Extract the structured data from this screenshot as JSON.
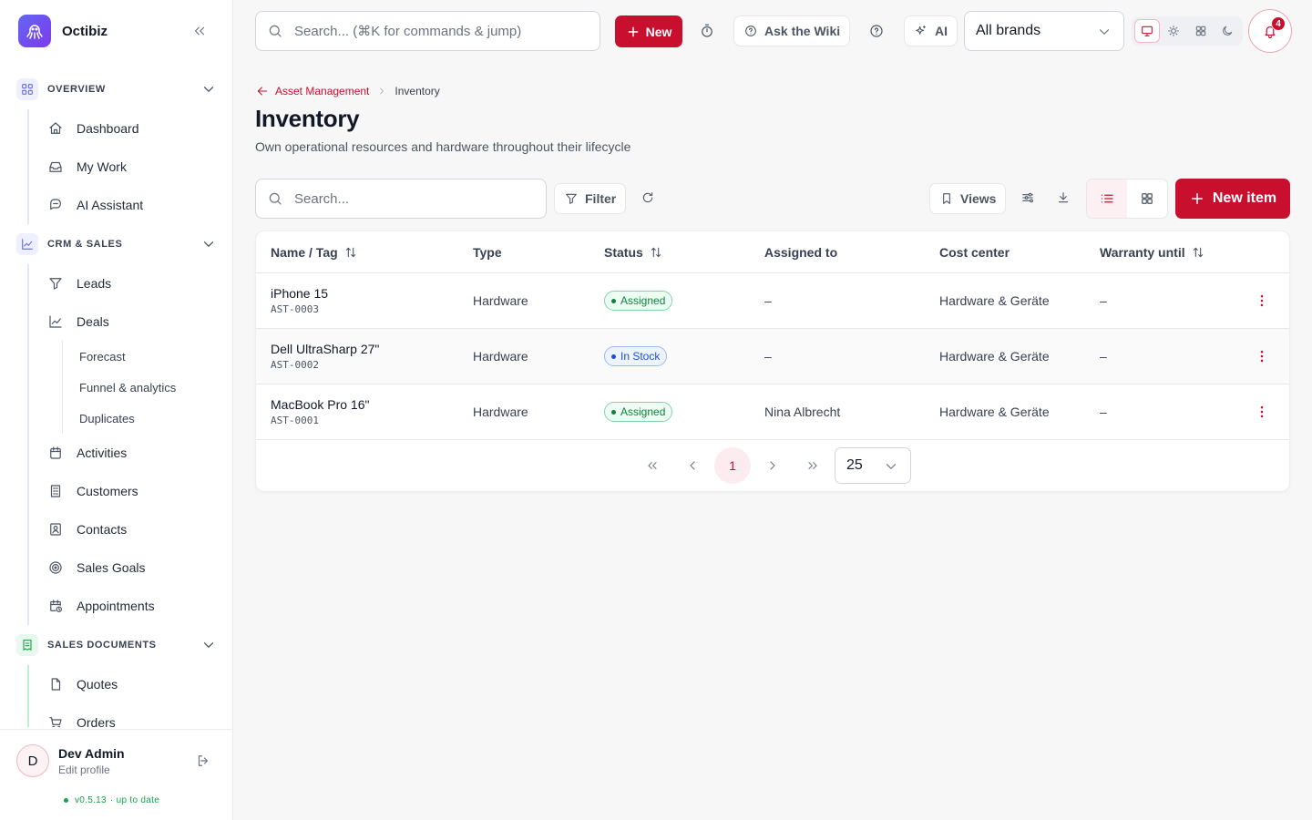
{
  "app": {
    "name": "Octibiz"
  },
  "topbar": {
    "search_placeholder": "Search... (⌘K for commands & jump)",
    "new_label": "New",
    "wiki_label": "Ask the Wiki",
    "ai_label": "AI",
    "brand_select": "All brands",
    "notifications_count": "4"
  },
  "sidebar": {
    "sections": [
      {
        "label": "OVERVIEW",
        "color": "#6366f1",
        "items": [
          "Dashboard",
          "My Work",
          "AI Assistant"
        ]
      },
      {
        "label": "CRM & SALES",
        "color": "#6366f1",
        "items": [
          "Leads",
          "Deals",
          "Activities",
          "Customers",
          "Contacts",
          "Sales Goals",
          "Appointments"
        ],
        "deals_sub": [
          "Forecast",
          "Funnel & analytics",
          "Duplicates"
        ]
      },
      {
        "label": "SALES DOCUMENTS",
        "color": "#16a34a",
        "items": [
          "Quotes",
          "Orders"
        ]
      }
    ],
    "user": {
      "initial": "D",
      "name": "Dev Admin",
      "edit": "Edit profile"
    },
    "version": "v0.5.13",
    "version_status": "· up to date"
  },
  "breadcrumb": {
    "parent": "Asset Management",
    "current": "Inventory"
  },
  "page": {
    "title": "Inventory",
    "subtitle": "Own operational resources and hardware throughout their lifecycle"
  },
  "toolbar": {
    "search_placeholder": "Search...",
    "filter_label": "Filter",
    "views_label": "Views",
    "new_item_label": "New item"
  },
  "table": {
    "columns": [
      "Name / Tag",
      "Type",
      "Status",
      "Assigned to",
      "Cost center",
      "Warranty until"
    ],
    "rows": [
      {
        "name": "iPhone 15",
        "tag": "AST-0003",
        "type": "Hardware",
        "status": "Assigned",
        "assigned": "–",
        "cost_center": "Hardware & Geräte",
        "warranty": "–"
      },
      {
        "name": "Dell UltraSharp 27\"",
        "tag": "AST-0002",
        "type": "Hardware",
        "status": "In Stock",
        "assigned": "–",
        "cost_center": "Hardware & Geräte",
        "warranty": "–"
      },
      {
        "name": "MacBook Pro 16\"",
        "tag": "AST-0001",
        "type": "Hardware",
        "status": "Assigned",
        "assigned": "Nina Albrecht",
        "cost_center": "Hardware & Geräte",
        "warranty": "–"
      }
    ]
  },
  "pagination": {
    "current_page": "1",
    "page_size": "25"
  },
  "colors": {
    "accent": "#c8102e",
    "assigned": "#15803d",
    "in_stock": "#1d4ed8"
  }
}
